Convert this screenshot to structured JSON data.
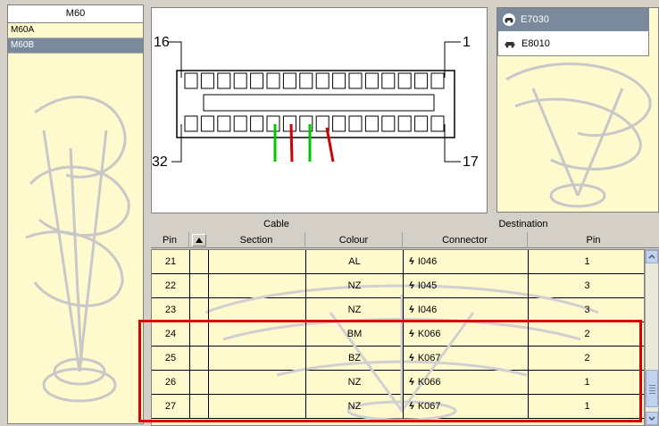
{
  "left_panel": {
    "title": "M60",
    "items": [
      {
        "label": "M60A",
        "selected": false
      },
      {
        "label": "M60B",
        "selected": true
      }
    ]
  },
  "diagram": {
    "label_top_left": "16",
    "label_top_right": "1",
    "label_bottom_left": "32",
    "label_bottom_right": "17",
    "pins_per_row": 16,
    "wires": [
      {
        "color": "#00c800"
      },
      {
        "color": "#d00000"
      },
      {
        "color": "#00c800"
      },
      {
        "color": "#d00000"
      }
    ]
  },
  "right_panel": {
    "items": [
      {
        "label": "E7030",
        "icon": "car-icon",
        "selected": true
      },
      {
        "label": "E8010",
        "icon": "car-icon",
        "selected": false
      }
    ]
  },
  "table": {
    "group_headers": {
      "cable": "Cable",
      "destination": "Destination"
    },
    "columns": {
      "pin": "Pin",
      "section": "Section",
      "colour": "Colour",
      "connector": "Connector",
      "dest_pin": "Pin"
    },
    "rows": [
      {
        "pin": "21",
        "section": "",
        "colour": "AL",
        "connector": "I046",
        "dest_pin": "1"
      },
      {
        "pin": "22",
        "section": "",
        "colour": "NZ",
        "connector": "I045",
        "dest_pin": "3"
      },
      {
        "pin": "23",
        "section": "",
        "colour": "NZ",
        "connector": "I046",
        "dest_pin": "3"
      },
      {
        "pin": "24",
        "section": "",
        "colour": "BM",
        "connector": "K066",
        "dest_pin": "2"
      },
      {
        "pin": "25",
        "section": "",
        "colour": "BZ",
        "connector": "K067",
        "dest_pin": "2"
      },
      {
        "pin": "26",
        "section": "",
        "colour": "NZ",
        "connector": "K066",
        "dest_pin": "1"
      },
      {
        "pin": "27",
        "section": "",
        "colour": "NZ",
        "connector": "K067",
        "dest_pin": "1"
      }
    ],
    "highlight_color": "#d80000"
  }
}
